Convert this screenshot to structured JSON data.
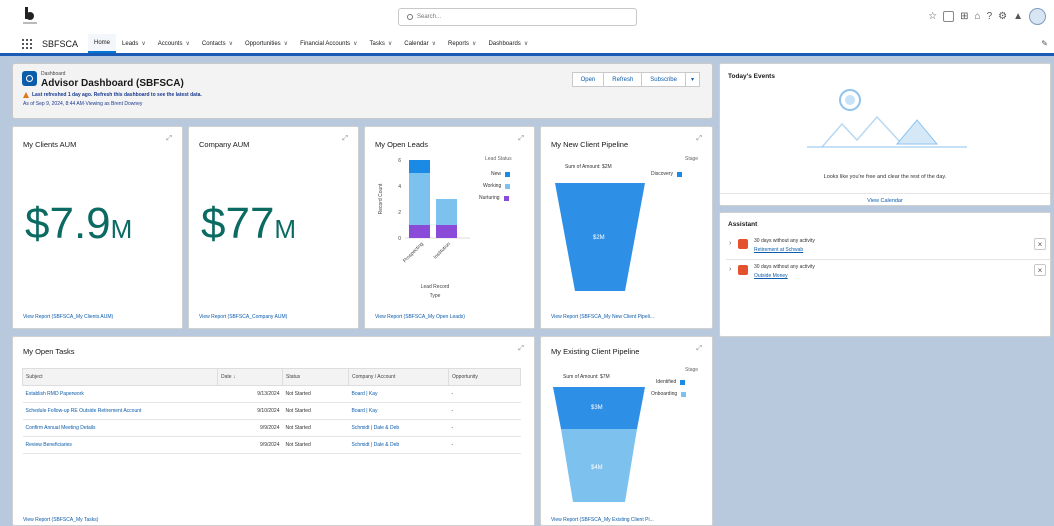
{
  "topbar": {
    "search_placeholder": "Search...",
    "utility_icons": [
      "favorites-icon",
      "add-icon",
      "help-icon",
      "setup-icon",
      "notifications-icon"
    ]
  },
  "nav": {
    "app_name": "SBFSCA",
    "items": [
      "Home",
      "Leads",
      "Accounts",
      "Contacts",
      "Opportunities",
      "Financial Accounts",
      "Tasks",
      "Calendar",
      "Reports",
      "Dashboards"
    ]
  },
  "header": {
    "object_label": "Dashboard",
    "title": "Advisor Dashboard (SBFSCA)",
    "warning": "Last refreshed 1 day ago. Refresh this dashboard to see the latest data.",
    "as_of": "As of Sep 9, 2024, 8:44 AM·Viewing as Brent Downey",
    "buttons": {
      "open": "Open",
      "refresh": "Refresh",
      "subscribe": "Subscribe"
    }
  },
  "clients_aum": {
    "title": "My Clients AUM",
    "value": "$7.9",
    "suffix": "M",
    "link": "View Report (SBFSCA_My Clients AUM)"
  },
  "company_aum": {
    "title": "Company AUM",
    "value": "$77",
    "suffix": "M",
    "link": "View Report (SBFSCA_Company AUM)"
  },
  "open_leads": {
    "title": "My Open Leads",
    "ylabel": "Record Count",
    "xlabel": "Lead Record Type",
    "legend_title": "Lead Status",
    "link": "View Report (SBFSCA_My Open Leads)",
    "colors": {
      "New": "#1b8ae5",
      "Working": "#7dc1ee",
      "Nurturing": "#8a4bd8"
    }
  },
  "new_pipeline": {
    "title": "My New Client Pipeline",
    "sum_label": "Sum of Amount: $2M",
    "legend_title": "Stage",
    "legend": [
      "Discovery"
    ],
    "segment_label": "$2M",
    "link": "View Report (SBFSCA_My New Client Pipeli..."
  },
  "existing_pipeline": {
    "title": "My Existing Client Pipeline",
    "sum_label": "Sum of Amount: $7M",
    "legend_title": "Stage",
    "legend": [
      "Identified",
      "Onboarding"
    ],
    "segments": [
      "$3M",
      "$4M"
    ],
    "link": "View Report (SBFSCA_My Existing Client Pi..."
  },
  "tasks": {
    "title": "My Open Tasks",
    "columns": [
      "Subject",
      "Date ↓",
      "Status",
      "Company / Account",
      "Opportunity"
    ],
    "rows": [
      [
        "Establish RMD Paperwork",
        "9/13/2024",
        "Not Started",
        "Board | Kay",
        "-"
      ],
      [
        "Schedule Follow-up RE Outside Retirement Account",
        "9/10/2024",
        "Not Started",
        "Board | Kay",
        "-"
      ],
      [
        "Confirm Annual Meeting Details",
        "9/9/2024",
        "Not Started",
        "Schmidt | Dale & Deb",
        "-"
      ],
      [
        "Review Beneficiaries",
        "9/9/2024",
        "Not Started",
        "Schmidt | Dale & Deb",
        "-"
      ]
    ],
    "link": "View Report (SBFSCA_My Tasks)"
  },
  "events": {
    "title": "Today's Events",
    "message": "Looks like you're free and clear the rest of the day.",
    "link": "View Calendar"
  },
  "assistant": {
    "title": "Assistant",
    "items": [
      {
        "line1": "30 days without any activity",
        "line2": "Retirement at Schwab"
      },
      {
        "line1": "30 days without any activity",
        "line2": "Outside Money"
      }
    ]
  },
  "chart_data": [
    {
      "type": "bar",
      "title": "My Open Leads",
      "categories": [
        "Prospecting",
        "Institution"
      ],
      "ylabel": "Record Count",
      "xlabel": "Lead Record Type",
      "ylim": [
        0,
        6
      ],
      "yticks": [
        0,
        2,
        4,
        6
      ],
      "stacked": true,
      "series": [
        {
          "name": "Nurturing",
          "values": [
            1,
            1
          ]
        },
        {
          "name": "Working",
          "values": [
            4,
            2
          ]
        },
        {
          "name": "New",
          "values": [
            1,
            0
          ]
        }
      ]
    },
    {
      "type": "funnel",
      "title": "My New Client Pipeline",
      "categories": [
        "Discovery"
      ],
      "values": [
        2
      ]
    },
    {
      "type": "funnel",
      "title": "My Existing Client Pipeline",
      "categories": [
        "Identified",
        "Onboarding"
      ],
      "values": [
        3,
        4
      ]
    }
  ]
}
